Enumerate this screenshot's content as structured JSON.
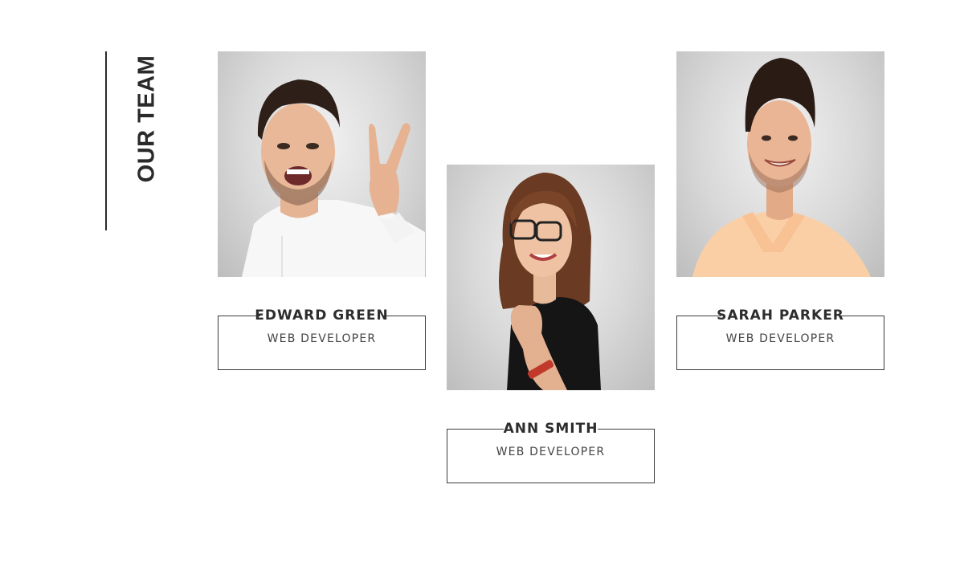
{
  "section": {
    "title": "OUR TEAM"
  },
  "team": [
    {
      "name": "EDWARD GREEN",
      "role": "WEB DEVELOPER",
      "photo_icon": "person-photo"
    },
    {
      "name": "ANN SMITH",
      "role": "WEB DEVELOPER",
      "photo_icon": "person-photo"
    },
    {
      "name": "SARAH PARKER",
      "role": "WEB DEVELOPER",
      "photo_icon": "person-photo"
    }
  ],
  "colors": {
    "text": "#2d2d2d",
    "border": "#3a3a3a",
    "background": "#ffffff"
  }
}
